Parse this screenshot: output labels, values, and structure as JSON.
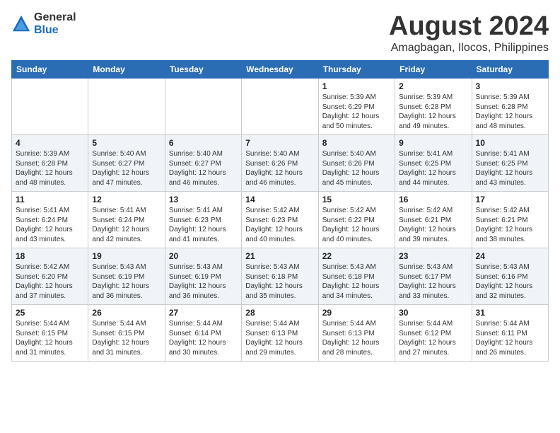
{
  "header": {
    "logo_general": "General",
    "logo_blue": "Blue",
    "title": "August 2024",
    "subtitle": "Amagbagan, Ilocos, Philippines"
  },
  "weekdays": [
    "Sunday",
    "Monday",
    "Tuesday",
    "Wednesday",
    "Thursday",
    "Friday",
    "Saturday"
  ],
  "weeks": [
    [
      {
        "day": "",
        "content": ""
      },
      {
        "day": "",
        "content": ""
      },
      {
        "day": "",
        "content": ""
      },
      {
        "day": "",
        "content": ""
      },
      {
        "day": "1",
        "content": "Sunrise: 5:39 AM\nSunset: 6:29 PM\nDaylight: 12 hours\nand 50 minutes."
      },
      {
        "day": "2",
        "content": "Sunrise: 5:39 AM\nSunset: 6:28 PM\nDaylight: 12 hours\nand 49 minutes."
      },
      {
        "day": "3",
        "content": "Sunrise: 5:39 AM\nSunset: 6:28 PM\nDaylight: 12 hours\nand 48 minutes."
      }
    ],
    [
      {
        "day": "4",
        "content": "Sunrise: 5:39 AM\nSunset: 6:28 PM\nDaylight: 12 hours\nand 48 minutes."
      },
      {
        "day": "5",
        "content": "Sunrise: 5:40 AM\nSunset: 6:27 PM\nDaylight: 12 hours\nand 47 minutes."
      },
      {
        "day": "6",
        "content": "Sunrise: 5:40 AM\nSunset: 6:27 PM\nDaylight: 12 hours\nand 46 minutes."
      },
      {
        "day": "7",
        "content": "Sunrise: 5:40 AM\nSunset: 6:26 PM\nDaylight: 12 hours\nand 46 minutes."
      },
      {
        "day": "8",
        "content": "Sunrise: 5:40 AM\nSunset: 6:26 PM\nDaylight: 12 hours\nand 45 minutes."
      },
      {
        "day": "9",
        "content": "Sunrise: 5:41 AM\nSunset: 6:25 PM\nDaylight: 12 hours\nand 44 minutes."
      },
      {
        "day": "10",
        "content": "Sunrise: 5:41 AM\nSunset: 6:25 PM\nDaylight: 12 hours\nand 43 minutes."
      }
    ],
    [
      {
        "day": "11",
        "content": "Sunrise: 5:41 AM\nSunset: 6:24 PM\nDaylight: 12 hours\nand 43 minutes."
      },
      {
        "day": "12",
        "content": "Sunrise: 5:41 AM\nSunset: 6:24 PM\nDaylight: 12 hours\nand 42 minutes."
      },
      {
        "day": "13",
        "content": "Sunrise: 5:41 AM\nSunset: 6:23 PM\nDaylight: 12 hours\nand 41 minutes."
      },
      {
        "day": "14",
        "content": "Sunrise: 5:42 AM\nSunset: 6:23 PM\nDaylight: 12 hours\nand 40 minutes."
      },
      {
        "day": "15",
        "content": "Sunrise: 5:42 AM\nSunset: 6:22 PM\nDaylight: 12 hours\nand 40 minutes."
      },
      {
        "day": "16",
        "content": "Sunrise: 5:42 AM\nSunset: 6:21 PM\nDaylight: 12 hours\nand 39 minutes."
      },
      {
        "day": "17",
        "content": "Sunrise: 5:42 AM\nSunset: 6:21 PM\nDaylight: 12 hours\nand 38 minutes."
      }
    ],
    [
      {
        "day": "18",
        "content": "Sunrise: 5:42 AM\nSunset: 6:20 PM\nDaylight: 12 hours\nand 37 minutes."
      },
      {
        "day": "19",
        "content": "Sunrise: 5:43 AM\nSunset: 6:19 PM\nDaylight: 12 hours\nand 36 minutes."
      },
      {
        "day": "20",
        "content": "Sunrise: 5:43 AM\nSunset: 6:19 PM\nDaylight: 12 hours\nand 36 minutes."
      },
      {
        "day": "21",
        "content": "Sunrise: 5:43 AM\nSunset: 6:18 PM\nDaylight: 12 hours\nand 35 minutes."
      },
      {
        "day": "22",
        "content": "Sunrise: 5:43 AM\nSunset: 6:18 PM\nDaylight: 12 hours\nand 34 minutes."
      },
      {
        "day": "23",
        "content": "Sunrise: 5:43 AM\nSunset: 6:17 PM\nDaylight: 12 hours\nand 33 minutes."
      },
      {
        "day": "24",
        "content": "Sunrise: 5:43 AM\nSunset: 6:16 PM\nDaylight: 12 hours\nand 32 minutes."
      }
    ],
    [
      {
        "day": "25",
        "content": "Sunrise: 5:44 AM\nSunset: 6:15 PM\nDaylight: 12 hours\nand 31 minutes."
      },
      {
        "day": "26",
        "content": "Sunrise: 5:44 AM\nSunset: 6:15 PM\nDaylight: 12 hours\nand 31 minutes."
      },
      {
        "day": "27",
        "content": "Sunrise: 5:44 AM\nSunset: 6:14 PM\nDaylight: 12 hours\nand 30 minutes."
      },
      {
        "day": "28",
        "content": "Sunrise: 5:44 AM\nSunset: 6:13 PM\nDaylight: 12 hours\nand 29 minutes."
      },
      {
        "day": "29",
        "content": "Sunrise: 5:44 AM\nSunset: 6:13 PM\nDaylight: 12 hours\nand 28 minutes."
      },
      {
        "day": "30",
        "content": "Sunrise: 5:44 AM\nSunset: 6:12 PM\nDaylight: 12 hours\nand 27 minutes."
      },
      {
        "day": "31",
        "content": "Sunrise: 5:44 AM\nSunset: 6:11 PM\nDaylight: 12 hours\nand 26 minutes."
      }
    ]
  ]
}
